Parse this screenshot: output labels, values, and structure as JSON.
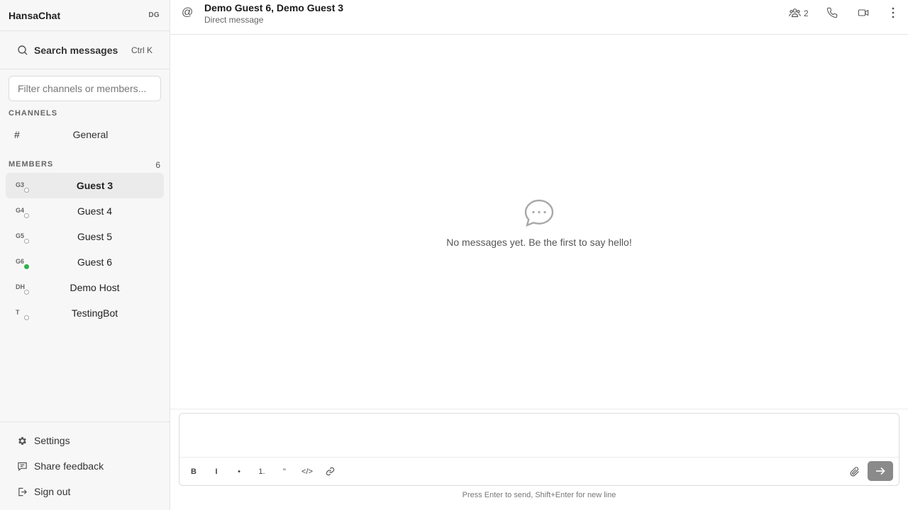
{
  "app": {
    "name": "HansaChat",
    "user_initials": "DG"
  },
  "search": {
    "label": "Search messages",
    "shortcut": "Ctrl K"
  },
  "filter": {
    "placeholder": "Filter channels or members..."
  },
  "channels": {
    "heading": "CHANNELS",
    "items": [
      {
        "prefix": "#",
        "label": "General"
      }
    ]
  },
  "members": {
    "heading": "MEMBERS",
    "count": "6",
    "items": [
      {
        "initials": "G3",
        "name": "Guest 3",
        "status": "offline",
        "active": true
      },
      {
        "initials": "G4",
        "name": "Guest 4",
        "status": "offline",
        "active": false
      },
      {
        "initials": "G5",
        "name": "Guest 5",
        "status": "offline",
        "active": false
      },
      {
        "initials": "G6",
        "name": "Guest 6",
        "status": "online",
        "active": false
      },
      {
        "initials": "DH",
        "name": "Demo Host",
        "status": "offline",
        "active": false
      },
      {
        "initials": "T",
        "name": "TestingBot",
        "status": "offline",
        "active": false
      }
    ]
  },
  "footer": {
    "settings": "Settings",
    "feedback": "Share feedback",
    "signout": "Sign out"
  },
  "header": {
    "icon": "@",
    "title": "Demo Guest 6, Demo Guest 3",
    "subtitle": "Direct message",
    "member_count": "2"
  },
  "empty_state": {
    "icon": "chat-bubble-icon",
    "text": "No messages yet. Be the first to say hello!"
  },
  "composer": {
    "bold": "B",
    "italic": "I",
    "bullet": "•",
    "ordered": "1.",
    "quote": "\"",
    "code": "</>",
    "hint": "Press Enter to send, Shift+Enter for new line"
  },
  "colors": {
    "sidebar_bg": "#f7f7f7",
    "active_row": "#ebebeb",
    "online": "#2fb34a",
    "send_button": "#8a8a8a"
  }
}
